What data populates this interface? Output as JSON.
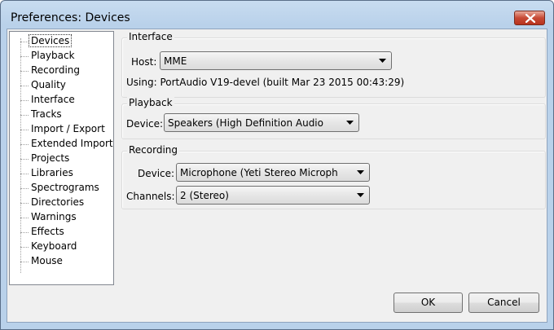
{
  "window": {
    "title": "Preferences: Devices"
  },
  "tree": {
    "items": [
      {
        "label": "Devices",
        "selected": true
      },
      {
        "label": "Playback"
      },
      {
        "label": "Recording"
      },
      {
        "label": "Quality"
      },
      {
        "label": "Interface"
      },
      {
        "label": "Tracks"
      },
      {
        "label": "Import / Export"
      },
      {
        "label": "Extended Import"
      },
      {
        "label": "Projects"
      },
      {
        "label": "Libraries"
      },
      {
        "label": "Spectrograms"
      },
      {
        "label": "Directories"
      },
      {
        "label": "Warnings"
      },
      {
        "label": "Effects"
      },
      {
        "label": "Keyboard"
      },
      {
        "label": "Mouse"
      }
    ]
  },
  "interface": {
    "title": "Interface",
    "host_label": "Host:",
    "host_value": "MME",
    "using_text": "Using: PortAudio V19-devel (built Mar 23 2015 00:43:29)"
  },
  "playback": {
    "title": "Playback",
    "device_label": "Device:",
    "device_value": "Speakers (High Definition Audio"
  },
  "recording": {
    "title": "Recording",
    "device_label": "Device:",
    "device_value": "Microphone (Yeti Stereo Microph",
    "channels_label": "Channels:",
    "channels_value": "2 (Stereo)"
  },
  "buttons": {
    "ok": "OK",
    "cancel": "Cancel"
  },
  "icons": {
    "close": "close-icon",
    "dropdown": "chevron-down-icon"
  }
}
